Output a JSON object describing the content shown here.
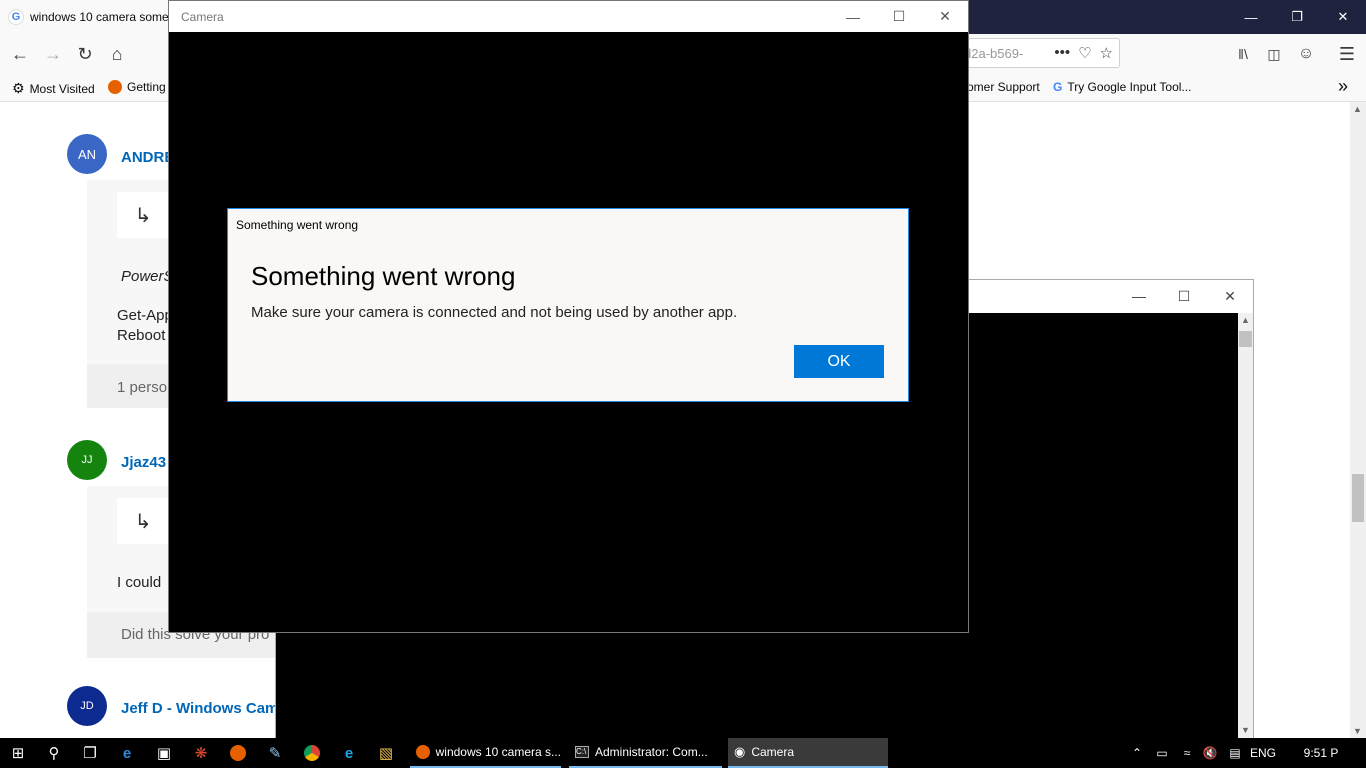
{
  "firefox": {
    "tab_title": "windows 10 camera some",
    "tab_icon_letter": "G",
    "url_fragment": "d2a-b569-",
    "url_menu": "•••",
    "bookmarks": [
      {
        "label": "Most Visited"
      },
      {
        "label": "Getting"
      },
      {
        "label": "omer Support"
      },
      {
        "label": "Try Google Input Tool..."
      }
    ],
    "bookmarks_overflow": "»"
  },
  "page": {
    "posts": [
      {
        "initials": "AN",
        "name": "ANDRE",
        "color": "#3a67c6"
      },
      {
        "initials": "JJ",
        "name": "Jjaz43",
        "color": "#15840f"
      },
      {
        "initials": "JD",
        "name": "Jeff D - Windows Came",
        "color": "#0d2a91"
      }
    ],
    "post1_italic": "PowerS",
    "post1_line1": "Get-App",
    "post1_line2": "Reboot",
    "post1_meta": "1 perso",
    "post2_text": "I could",
    "post2_meta": "Did this solve your pro"
  },
  "camera": {
    "title": "Camera"
  },
  "dialog": {
    "small_title": "Something went wrong",
    "heading": "Something went wrong",
    "message": "Make sure your camera is connected and not being used by another app.",
    "ok_label": "OK"
  },
  "taskbar": {
    "tasks": [
      {
        "label": "windows 10 camera s..."
      },
      {
        "label": "Administrator: Com..."
      },
      {
        "label": "Camera"
      }
    ],
    "language": "ENG",
    "time": "9:51 P"
  },
  "colors": {
    "accent": "#0078d7",
    "titlebar": "#202340",
    "link": "#0067b8"
  }
}
